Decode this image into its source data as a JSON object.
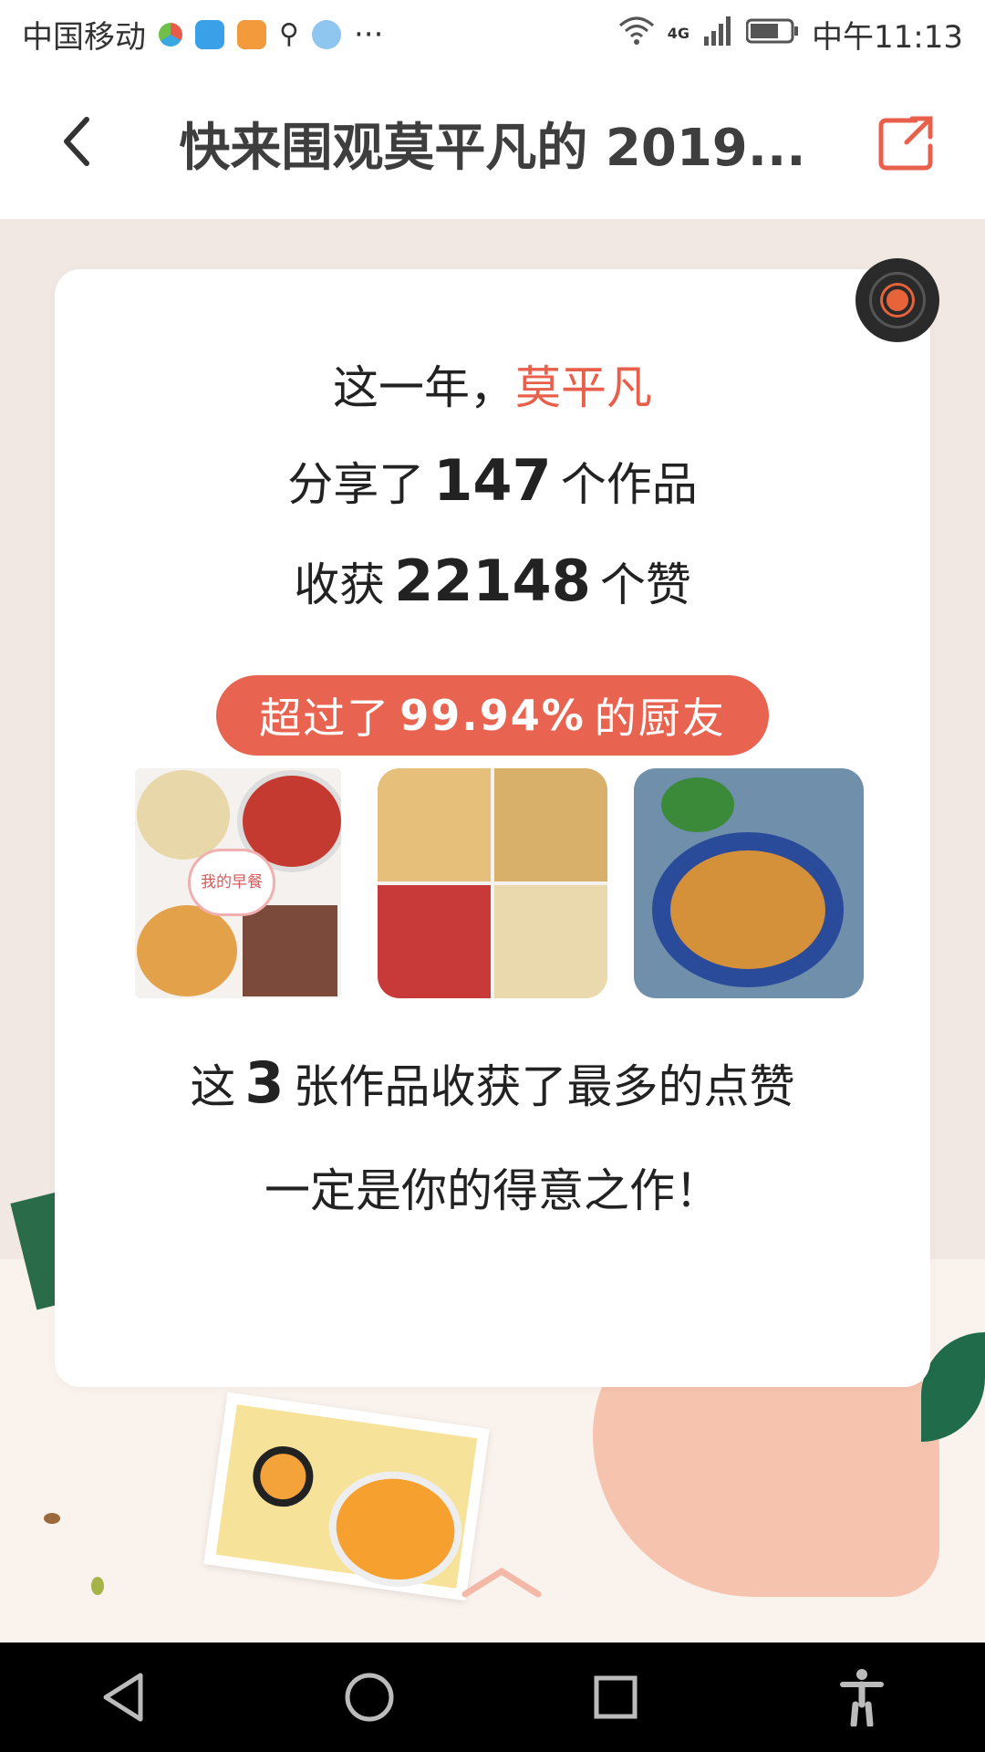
{
  "status_bar": {
    "carrier": "中国移动",
    "more": "···",
    "network": "4G",
    "time": "中午11:13"
  },
  "header": {
    "title": "快来围观莫平凡的 2019...",
    "back_icon": "chevron-left-icon",
    "share_icon": "share-icon"
  },
  "card": {
    "line1_prefix": "这一年，",
    "user_name": "莫平凡",
    "line2_prefix": "分享了",
    "works_count": "147",
    "line2_suffix": "个作品",
    "line3_prefix": "收获",
    "likes_count": "22148",
    "line3_suffix": "个赞",
    "badge_prefix": "超过了",
    "badge_percent": "99.94%",
    "badge_suffix": "的厨友",
    "collage_tag": "我的早餐",
    "top_prefix": "这",
    "top_count": "3",
    "top_suffix": "张作品收获了最多的点赞",
    "closing": "一定是你的得意之作！"
  },
  "colors": {
    "accent": "#e86451",
    "name": "#e8604c",
    "page_bg": "#f1e8e3"
  },
  "nav": {
    "back": "triangle-back-icon",
    "home": "circle-home-icon",
    "recents": "square-recents-icon",
    "accessibility": "accessibility-icon"
  }
}
